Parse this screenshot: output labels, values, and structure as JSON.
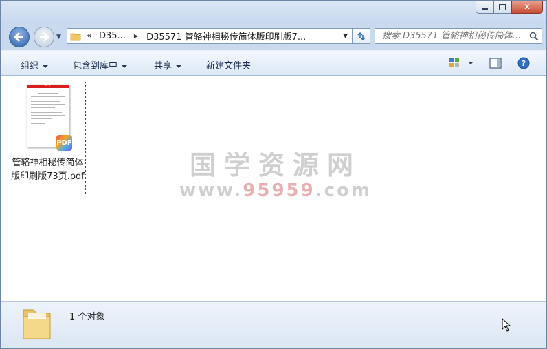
{
  "address": {
    "chevron": "«",
    "crumbs": [
      "D35...",
      "D35571 管辂神相秘传简体版印刷版7..."
    ]
  },
  "search": {
    "placeholder": "搜索 D35571 管辂神相秘传简体..."
  },
  "toolbar": {
    "organize": "组织",
    "include_library": "包含到库中",
    "share": "共享",
    "new_folder": "新建文件夹"
  },
  "file": {
    "name": "管辂神相秘传简体版印刷版73页.pdf",
    "thumb_header": "PDF",
    "badge": "PDF"
  },
  "watermark": {
    "title": "国学资源网",
    "url_prefix": "www.",
    "url_number": "95959",
    "url_suffix": ".com"
  },
  "status": {
    "count": "1 个对象"
  },
  "colors": {
    "accent_red": "#d81e1e",
    "watermark_red": "#e8b0b0",
    "window_frame": "#c9d9ee"
  },
  "icons": [
    "back-icon",
    "forward-icon",
    "folder-icon",
    "refresh-icon",
    "search-icon",
    "views-icon",
    "preview-pane-icon",
    "help-icon",
    "minimize-icon",
    "maximize-icon",
    "close-icon",
    "pdf-file-icon",
    "mouse-cursor"
  ]
}
